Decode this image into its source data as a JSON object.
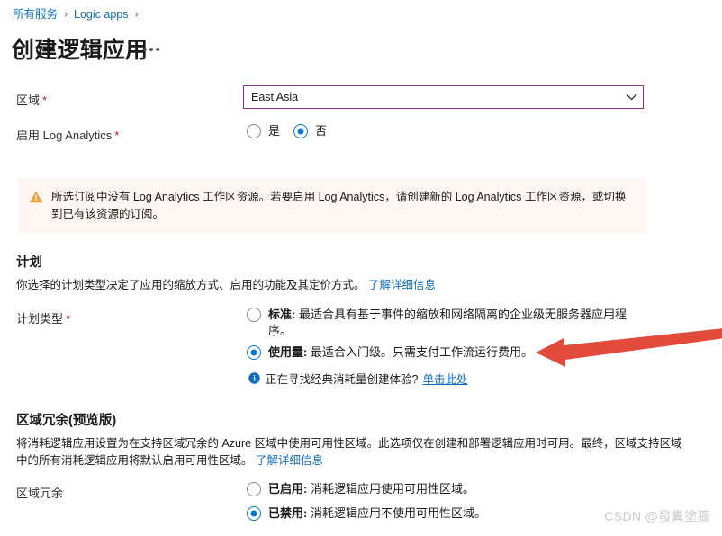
{
  "breadcrumb": {
    "items": [
      {
        "label": "所有服务"
      },
      {
        "label": "Logic apps"
      }
    ],
    "separator": "›"
  },
  "header": {
    "title": "创建逻辑应用",
    "more_label": "•••"
  },
  "region_field": {
    "label": "区域",
    "required_mark": "*",
    "value": "East Asia",
    "caret_icon": "chevron-down-icon"
  },
  "log_analytics_field": {
    "label": "启用 Log Analytics",
    "required_mark": "*",
    "options": [
      {
        "label": "是",
        "checked": false
      },
      {
        "label": "否",
        "checked": true
      }
    ]
  },
  "warning_banner": {
    "icon": "warning-triangle-icon",
    "text": "所选订阅中没有 Log Analytics 工作区资源。若要启用 Log Analytics，请创建新的 Log Analytics 工作区资源，或切换到已有该资源的订阅。",
    "background_color": "#fdf6f2",
    "icon_color": "#e8a33d"
  },
  "plan_section": {
    "title": "计划",
    "description": "你选择的计划类型决定了应用的缩放方式、启用的功能及其定价方式。",
    "learn_more": "了解详细信息",
    "type_label": "计划类型",
    "required_mark": "*",
    "options": [
      {
        "bold": "标准:",
        "text": " 最适合具有基于事件的缩放和网络隔离的企业级无服务器应用程序。",
        "checked": false
      },
      {
        "bold": "使用量:",
        "text": " 最适合入门级。只需支付工作流运行费用。",
        "checked": true
      }
    ],
    "info_note": {
      "icon": "info-circle-icon",
      "text": "正在寻找经典消耗量创建体验?",
      "link": "单击此处"
    }
  },
  "zone_section": {
    "title": "区域冗余(预览版)",
    "description": "将消耗逻辑应用设置为在支持区域冗余的 Azure 区域中使用可用性区域。此选项仅在创建和部署逻辑应用时可用。最终，区域支持区域中的所有消耗逻辑应用将默认启用可用性区域。",
    "learn_more": "了解详细信息",
    "field_label": "区域冗余",
    "options": [
      {
        "bold": "已启用:",
        "text": " 消耗逻辑应用使用可用性区域。",
        "checked": false
      },
      {
        "bold": "已禁用:",
        "text": " 消耗逻辑应用不使用可用性区域。",
        "checked": true
      }
    ]
  },
  "annotation": {
    "name": "red-arrow-annotation",
    "color": "#e24b3c",
    "points_to": "使用量"
  },
  "watermark": {
    "text": "CSDN @發糞塗牆"
  },
  "colors": {
    "link": "#0f6cbd",
    "accent": "#0078d4",
    "required": "#a4262c",
    "dropdown_border": "#8e2f8e",
    "warning_bg": "#fdf6f2"
  }
}
